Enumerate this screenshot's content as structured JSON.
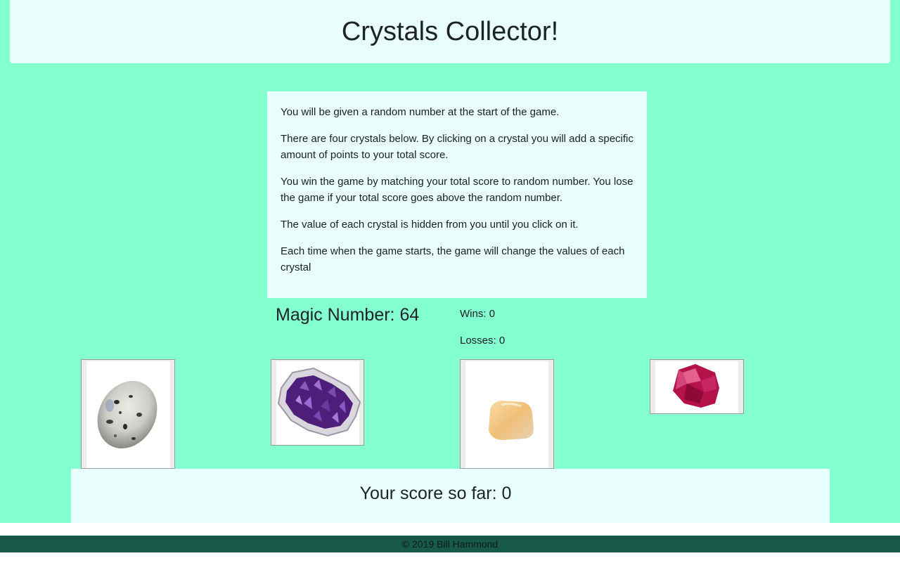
{
  "header": {
    "title": "Crystals Collector!"
  },
  "instructions": {
    "paragraphs": [
      "You will be given a random number at the start of the game.",
      "There are four crystals below. By clicking on a crystal you will add a specific amount of points to your total score.",
      "You win the game by matching your total score to random number. You lose the game if your total score goes above the random number.",
      "The value of each crystal is hidden from you until you click on it.",
      "Each time when the game starts, the game will change the values of each crystal"
    ]
  },
  "game": {
    "magic_number_text": "Magic Number: 64",
    "wins_text": "Wins: 0",
    "losses_text": "Losses: 0",
    "score_text": "Your score so far: 0"
  },
  "crystals": [
    {
      "icon": "moonstone-crystal-icon",
      "color": "#c9c9c4"
    },
    {
      "icon": "amethyst-geode-crystal-icon",
      "color": "#4b1e73"
    },
    {
      "icon": "citrine-crystal-icon",
      "color": "#f0c78a"
    },
    {
      "icon": "pink-tourmaline-crystal-icon",
      "color": "#b5114a"
    }
  ],
  "footer": {
    "text": "© 2019 Bill Hammond"
  },
  "colors": {
    "page_background": "#83ffd0",
    "panel_background": "#e9fffd",
    "footer_background": "#175a4a"
  }
}
